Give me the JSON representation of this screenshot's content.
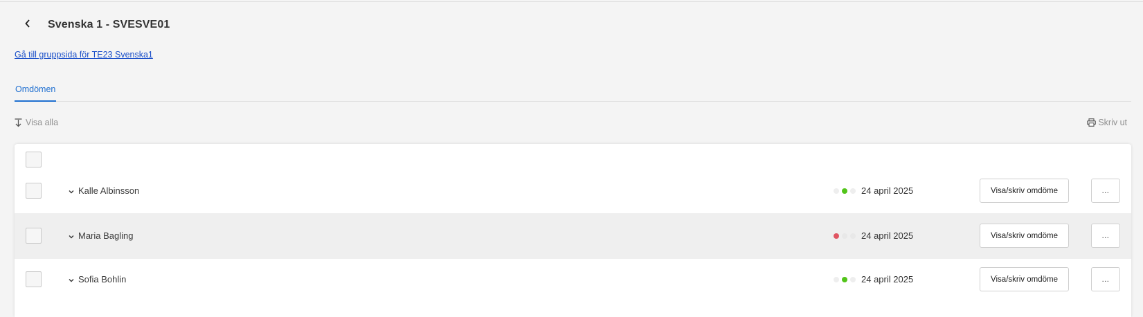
{
  "header": {
    "back_icon": "chevron-left-icon",
    "title": "Svenska 1 - SVESVE01"
  },
  "group_link": "Gå till gruppsida för TE23 Svenska1",
  "tabs": [
    {
      "label": "Omdömen",
      "active": true
    }
  ],
  "toolbar": {
    "show_all_icon": "expand-all-icon",
    "show_all_label": "Visa alla",
    "print_icon": "printer-icon",
    "print_label": "Skriv ut"
  },
  "students": [
    {
      "name": "Kalle Albinsson",
      "indicator": [
        "empty",
        "green",
        "empty"
      ],
      "date": "24 april 2025",
      "view_label": "Visa/skriv omdöme",
      "more_label": "..."
    },
    {
      "name": "Maria Bagling",
      "indicator": [
        "red",
        "empty",
        "empty"
      ],
      "date": "24 april 2025",
      "view_label": "Visa/skriv omdöme",
      "more_label": "..."
    },
    {
      "name": "Sofia Bohlin",
      "indicator": [
        "empty",
        "green",
        "empty"
      ],
      "date": "24 april 2025",
      "view_label": "Visa/skriv omdöme",
      "more_label": "..."
    }
  ],
  "colors": {
    "accent": "#1f6fd0",
    "link": "#1a4fc9",
    "status_green": "#52c41a",
    "status_red": "#e05562"
  }
}
